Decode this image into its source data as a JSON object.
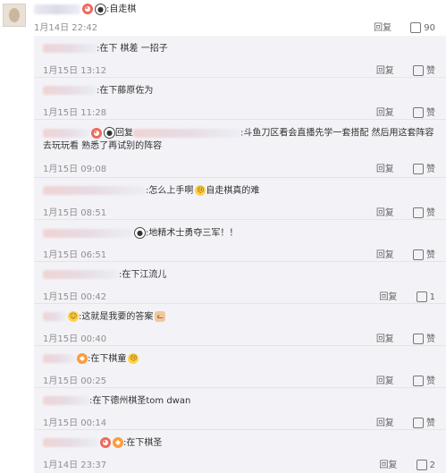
{
  "main": {
    "content": ":自走棋",
    "date": "1月14日 22:42",
    "reply_label": "回复",
    "like_count": "90"
  },
  "replies": [
    {
      "content": ":在下 棋差 一招子",
      "date": "1月15日 13:12",
      "reply_label": "回复",
      "like_label": "赞"
    },
    {
      "content": ":在下藤原佐为",
      "date": "1月15日 11:28",
      "reply_label": "回复",
      "like_label": "赞"
    },
    {
      "content": "回复",
      "content2": ":斗鱼刀区看会直播先学一套搭配 然后用这套阵容去玩玩看 熟悉了再试别的阵容",
      "date": "1月15日 09:08",
      "reply_label": "回复",
      "like_label": "赞"
    },
    {
      "content": ":怎么上手啊",
      "content2": "自走棋真的难",
      "date": "1月15日 08:51",
      "reply_label": "回复",
      "like_label": "赞"
    },
    {
      "content": ":地精术士勇夺三军！！",
      "date": "1月15日 06:51",
      "reply_label": "回复",
      "like_label": "赞"
    },
    {
      "content": ":在下江流儿",
      "date": "1月15日 00:42",
      "reply_label": "回复",
      "like_count": "1"
    },
    {
      "content": ":这就是我要的答案",
      "date": "1月15日 00:40",
      "reply_label": "回复",
      "like_label": "赞"
    },
    {
      "content": ":在下棋童",
      "date": "1月15日 00:25",
      "reply_label": "回复",
      "like_label": "赞"
    },
    {
      "content": ":在下德州棋圣tom dwan",
      "date": "1月15日 00:14",
      "reply_label": "回复",
      "like_label": "赞"
    },
    {
      "content": ":在下棋圣",
      "date": "1月14日 23:37",
      "reply_label": "回复",
      "like_count": "2"
    }
  ]
}
